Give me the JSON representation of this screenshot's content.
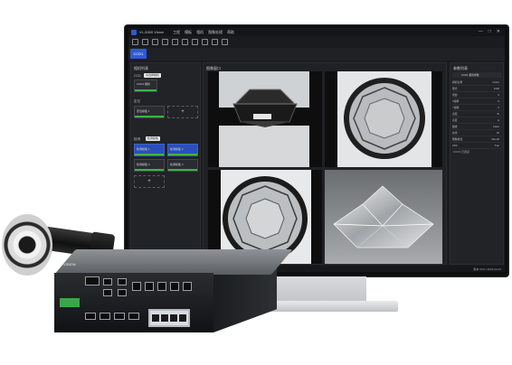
{
  "app": {
    "title": "VL-5000 Vision",
    "menu": [
      "工程",
      "模板",
      "相机",
      "图像处理",
      "帮助"
    ],
    "window_controls": [
      "—",
      "□",
      "✕"
    ]
  },
  "tabs": [
    {
      "label": "CCD1",
      "active": true
    }
  ],
  "left_panel": {
    "header": "相机列表",
    "section_camera": "CCD",
    "camera_hint": "请选择相机",
    "camera_card": "CCD1 相机",
    "section_position": "定位",
    "position_card": "定位模板 1",
    "section_detect": "检测",
    "detect_hint": "检测模板",
    "detect_cards": [
      "检测模板 1",
      "检测模板 2",
      "检测模板 3",
      "检测模板 4"
    ],
    "status_time": "检测耗时: 158ms"
  },
  "image_panel": {
    "header": "图像窗口"
  },
  "right_panel": {
    "header": "参数列表",
    "sub_header": "CCD1 相机参数",
    "params": [
      {
        "label": "相机名称",
        "value": "CCD1"
      },
      {
        "label": "曝光",
        "value": "1000"
      },
      {
        "label": "增益",
        "value": "0"
      },
      {
        "label": "X偏移",
        "value": "0"
      },
      {
        "label": "Y偏移",
        "value": "0"
      },
      {
        "label": "宽度",
        "value": "W"
      },
      {
        "label": "高度",
        "value": "H"
      },
      {
        "label": "触发",
        "value": "False"
      },
      {
        "label": "帧率",
        "value": "30"
      },
      {
        "label": "图像格式",
        "value": "Mono8"
      },
      {
        "label": "ADC",
        "value": "True"
      }
    ],
    "footer": "CCD1 已连接"
  },
  "statusbar": {
    "left": "系统运行 | 图像 CCD1 | 耗时 158ms",
    "right": "版本 V5.0 | 2023-03-01"
  },
  "hardware": {
    "brand": "VISION"
  },
  "colors": {
    "accent": "#2f59d9",
    "ok": "#39b54a",
    "panel": "#222327"
  }
}
